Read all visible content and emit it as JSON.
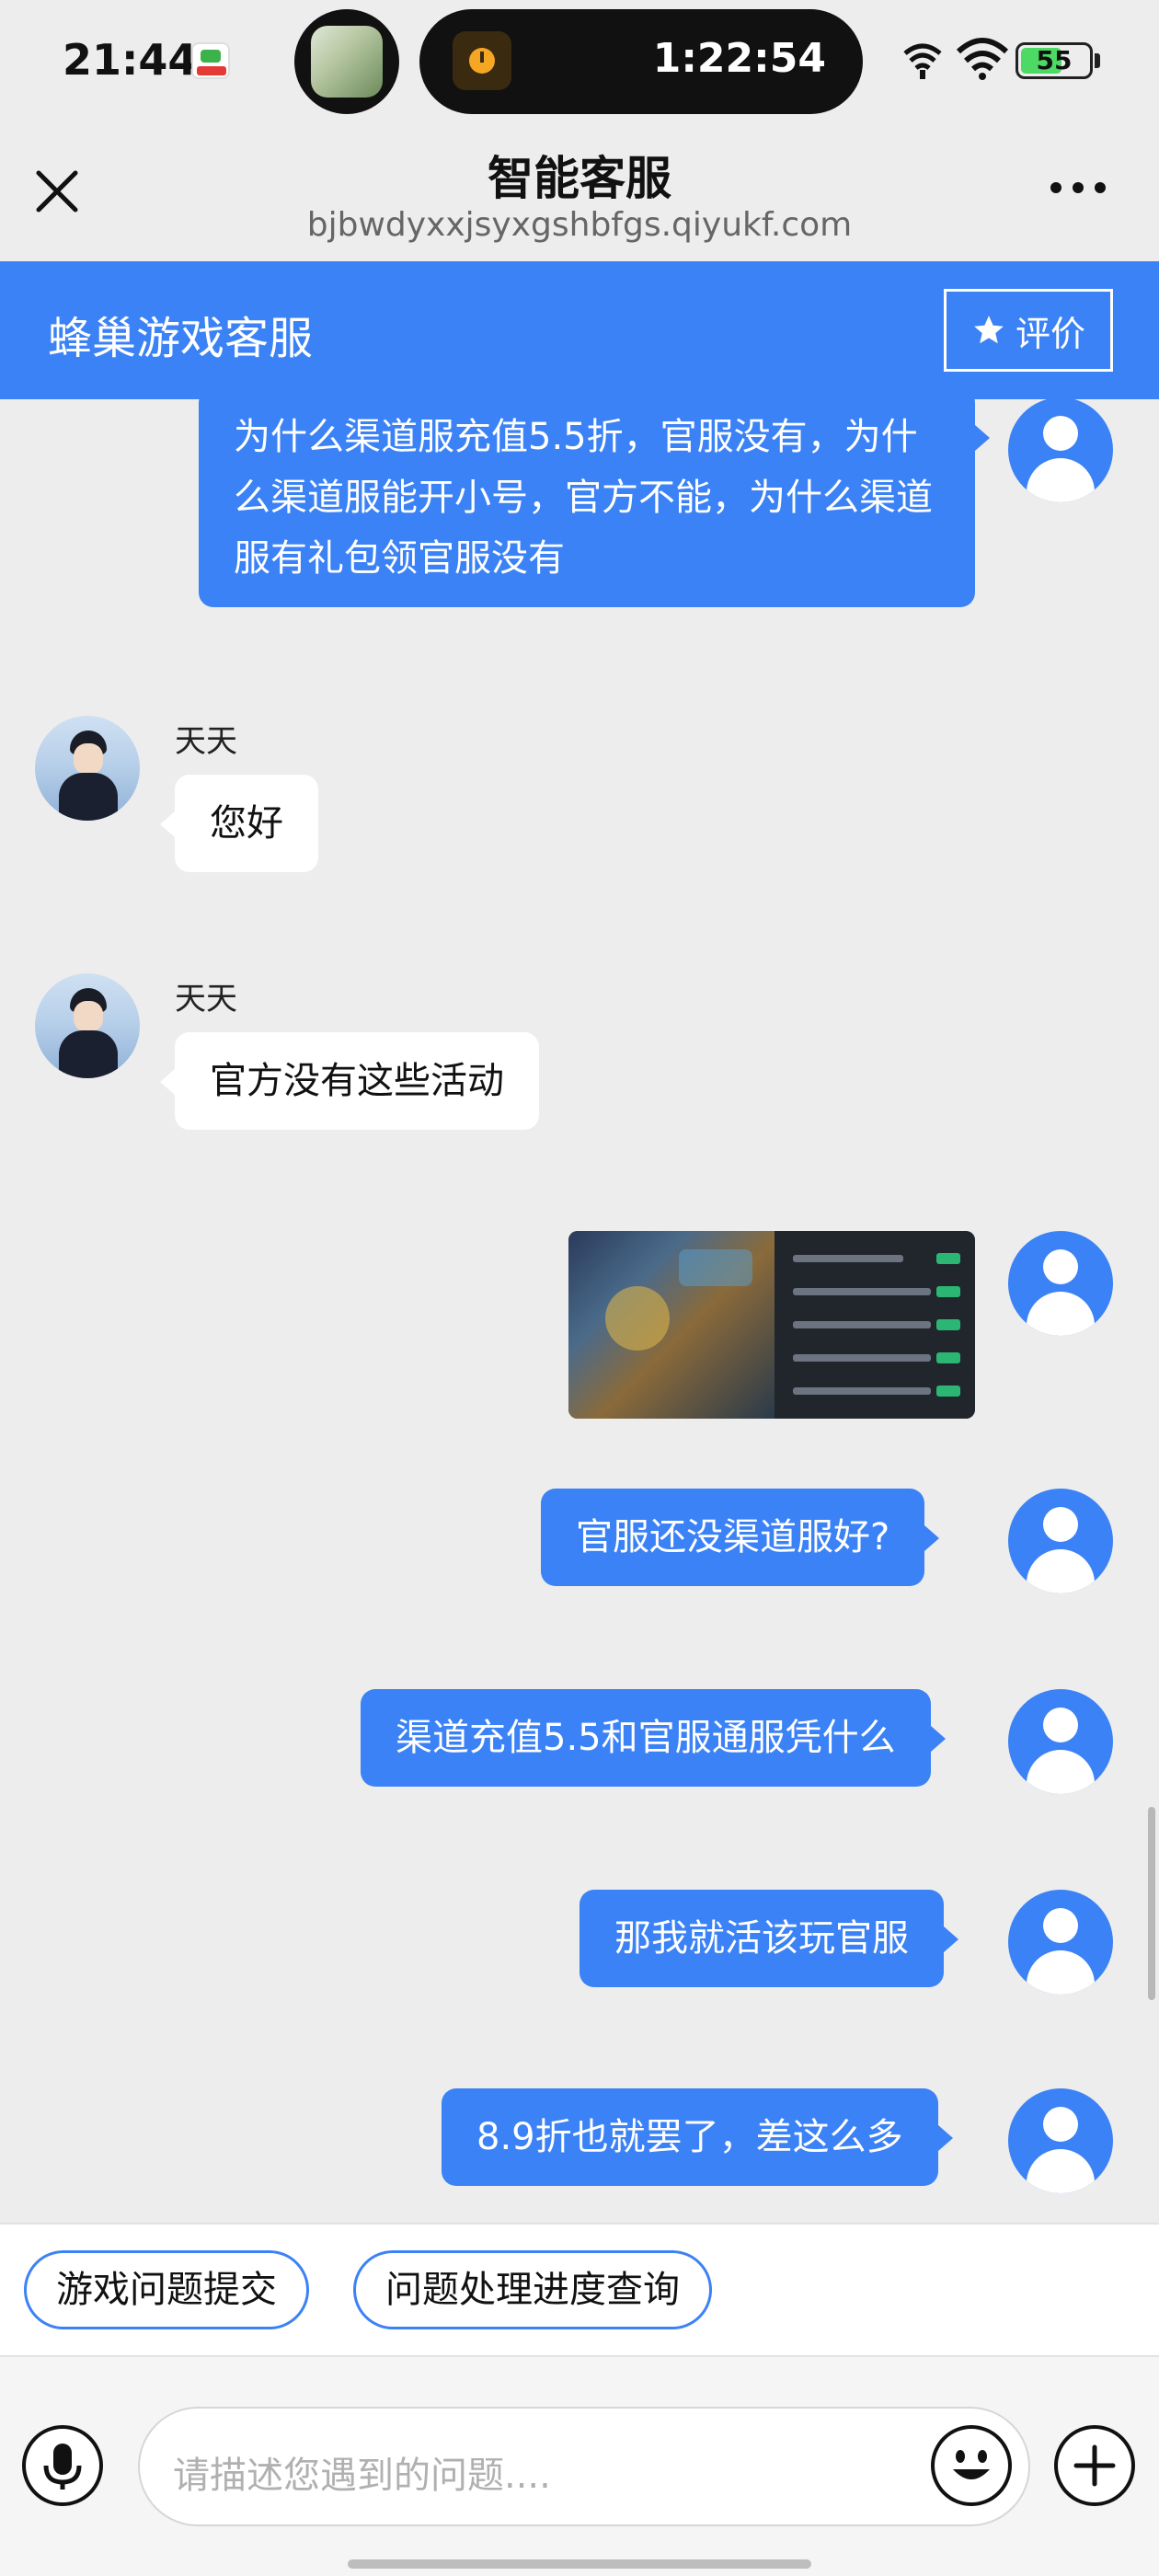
{
  "status_bar": {
    "time": "21:44",
    "timer": "1:22:54",
    "battery": "55",
    "battery_color": "#4cd964"
  },
  "nav": {
    "title": "智能客服",
    "subtitle": "bjbwdyxxjsyxgshbfgs.qiyukf.com",
    "close_icon": "close-icon",
    "more_icon": "more-icon"
  },
  "header": {
    "title": "蜂巢游戏客服",
    "rate_label": "评价",
    "accent_color": "#3b82f6"
  },
  "messages": [
    {
      "from": "user",
      "type": "text",
      "text": "为什么渠道服充值5.5折，官服没有，为什么渠道服能开小号，官方不能，为什么渠道服有礼包领官服没有"
    },
    {
      "from": "agent",
      "name": "天天",
      "type": "text",
      "text": "您好"
    },
    {
      "from": "agent",
      "name": "天天",
      "type": "text",
      "text": "官方没有这些活动"
    },
    {
      "from": "user",
      "type": "image",
      "text": ""
    },
    {
      "from": "user",
      "type": "text",
      "text": "官服还没渠道服好?"
    },
    {
      "from": "user",
      "type": "text",
      "text": "渠道充值5.5和官服通服凭什么"
    },
    {
      "from": "user",
      "type": "text",
      "text": "那我就活该玩官服"
    },
    {
      "from": "user",
      "type": "text",
      "text": "8.9折也就罢了，差这么多"
    }
  ],
  "quick_actions": [
    "游戏问题提交",
    "问题处理进度查询"
  ],
  "input": {
    "placeholder": "请描述您遇到的问题....",
    "mic_icon": "microphone-icon",
    "emoji_icon": "emoji-icon",
    "plus_icon": "plus-icon"
  }
}
